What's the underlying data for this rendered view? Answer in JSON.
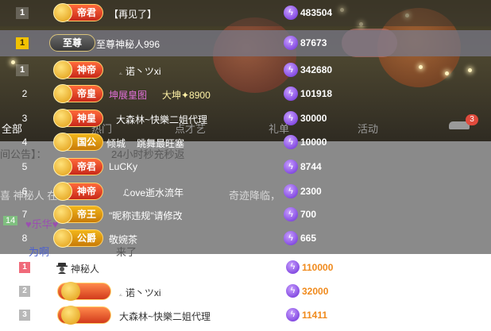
{
  "background": {
    "tabs": [
      "全部",
      "热门",
      "点才艺",
      "礼单",
      "活动"
    ],
    "tab_badge": "3",
    "ghost_lines": [
      "间公告】：",
      "24小时秒充秒返",
      "喜 神秘人 在",
      "奇迹降临，",
      "14",
      "♥乐华♥",
      "为啊",
      "来了"
    ]
  },
  "ranking": [
    {
      "rank": "1",
      "badge": "帝君",
      "name": "【再见了】",
      "value": "483504",
      "style": "box"
    },
    {
      "rank": "1",
      "badge": "至尊",
      "name": "至尊神秘人996",
      "value": "87673",
      "style": "gold"
    },
    {
      "rank": "1",
      "badge": "神帝",
      "name": "ۦ 诺丶ツxi",
      "value": "342680",
      "style": "box"
    },
    {
      "rank": "2",
      "badge": "帝皇",
      "name": "坤展皇图",
      "name_suffix": "大坤✦8900",
      "value": "101918",
      "style": "plain"
    },
    {
      "rank": "3",
      "badge": "神皇",
      "name": "大森林~快樂二姐代理",
      "value": "30000",
      "style": "plain"
    },
    {
      "rank": "4",
      "badge": "国公",
      "name": "倾城",
      "name_suffix": "跳舞最旺塞",
      "value": "10000",
      "style": "plain"
    },
    {
      "rank": "5",
      "badge": "帝君",
      "name": "LuCKy",
      "value": "8744",
      "style": "plain"
    },
    {
      "rank": "6",
      "badge": "神帝",
      "name": "ℒove逝水流年",
      "value": "2300",
      "style": "plain"
    },
    {
      "rank": "7",
      "badge": "帝王",
      "name": "\"昵称违规\"请修改",
      "value": "700",
      "style": "plain"
    },
    {
      "rank": "8",
      "badge": "公爵",
      "name": "敬婉茶",
      "value": "665",
      "style": "plain"
    }
  ],
  "bottom_list": [
    {
      "rank": "1",
      "name": "神秘人",
      "value": "110000"
    },
    {
      "rank": "2",
      "name": "ۦ 诺丶ツxi",
      "value": "32000"
    },
    {
      "rank": "3",
      "name": "大森林~快樂二姐代理",
      "value": "11411"
    }
  ],
  "colors": {
    "value_orange": "#f08a1c",
    "gold_rank": "#f2c200",
    "rank1_pink": "#f06a7a"
  }
}
